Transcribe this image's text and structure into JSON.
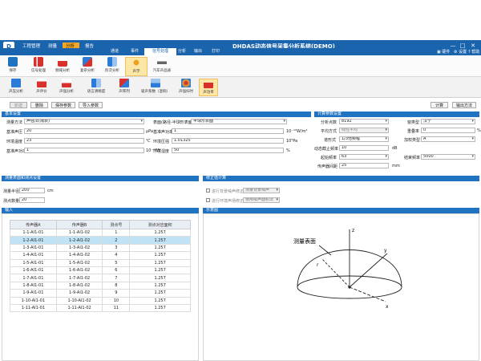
{
  "titlebar": {
    "logo": "D",
    "workflow": [
      "工程管理",
      "测量",
      "分析",
      "报告"
    ],
    "title": "DHDAS动态信号采集分析系统(DEMO)",
    "win_controls": [
      "—",
      "□",
      "✕"
    ]
  },
  "ribbon": {
    "tabs": [
      "通道",
      "事件",
      "信号处理",
      "分析",
      "输出",
      "打印"
    ],
    "active_tab": "信号处理",
    "right_items": [
      "硬件",
      "设置",
      "帮助"
    ]
  },
  "toolbar": [
    {
      "label": "保存",
      "icon": "save-icon",
      "color": "#1f73c1"
    },
    {
      "label": "信号处理",
      "icon": "signal-processing-icon",
      "color": "#d9302c"
    },
    {
      "label": "频域分析",
      "icon": "frequency-analysis-icon",
      "color": "#d9302c"
    },
    {
      "label": "复杂分析",
      "icon": "complex-analysis-icon",
      "color": "#2c7bd9"
    },
    {
      "label": "阶次分析",
      "icon": "order-analysis-icon",
      "color": "#2c7bd9"
    },
    {
      "label": "声学",
      "icon": "acoustics-icon",
      "color": "#f0a020"
    },
    {
      "label": "汽车声品质",
      "icon": "car-sound-quality-icon",
      "color": "#555"
    }
  ],
  "subbar": [
    {
      "label": "声压分析",
      "color": "#2c7bd9"
    },
    {
      "label": "声评价",
      "color": "#d9302c"
    },
    {
      "label": "声强分析",
      "color": "#d9302c"
    },
    {
      "label": "语言清晰度",
      "color": "#2c7bd9"
    },
    {
      "label": "声阵列",
      "color": "#d9302c"
    },
    {
      "label": "吸声系数（混响）",
      "color": "#2c7bd9"
    },
    {
      "label": "声强扫时",
      "color": "#c33"
    },
    {
      "label": "声功率",
      "color": "#d9302c"
    }
  ],
  "actions": {
    "new": "新建",
    "delete": "删除",
    "save_params": "保存参数",
    "import_params": "导入参数",
    "calculate": "计算",
    "export": "输出方法"
  },
  "basic": {
    "header": "基本设置",
    "method_label": "测量方法",
    "method_value": "声强法(隔表)",
    "surface_label": "表面(路径-半球形表面",
    "surface_value": "半球形表面",
    "ref_pressure_label": "基准声压",
    "ref_pressure_value": "20",
    "ref_pressure_unit": "μPa",
    "ref_power_label": "基准声功率",
    "ref_power_value": "1",
    "ref_power_unit": "10⁻¹²W/m²",
    "temp_label": "环境温度",
    "temp_value": "23",
    "temp_unit": "℃",
    "pressure_label": "环境压强",
    "pressure_value": "1.01325",
    "pressure_unit": "10⁵Pa",
    "ref_sound_power_label": "基准声功率",
    "ref_sound_power_value": "1",
    "ref_sound_power_unit": "10⁻¹²W",
    "humidity_label": "环境湿度",
    "humidity_value": "50",
    "humidity_unit": "%"
  },
  "calc": {
    "header": "计算参数设置",
    "points_label": "分析点数",
    "points_value": "8192",
    "window_label": "窗类型",
    "window_value": "汉宁",
    "avg_mode_label": "平均方式",
    "avg_mode_value": "线性平均",
    "overlap_label": "重叠率",
    "overlap_value": "0",
    "overlap_unit": "%",
    "band_label": "谱形式",
    "band_value": "1/3倍频程",
    "weight_label": "加权类型",
    "weight_value": "A",
    "dynamic_label": "动态截止频率",
    "dynamic_value": "10",
    "dynamic_unit": "dB",
    "start_freq_label": "起始频率",
    "start_freq_value": "63",
    "end_freq_label": "结束频率",
    "end_freq_value": "5000",
    "radius_label": "传声器间距",
    "radius_value": "25",
    "radius_unit": "mm"
  },
  "measure": {
    "header": "测量表面和测点设置",
    "radius_label": "测量半径",
    "radius_value": "200",
    "radius_unit": "cm",
    "points_label": "测点数量",
    "points_value": "20"
  },
  "correction": {
    "header": "修正值计算",
    "bg_label": "进行背景噪声修正",
    "bg_value": "测量背景噪声",
    "env_label": "进行环境声场修正",
    "env_value": "使用吸声面积法"
  },
  "input": {
    "header": "输入",
    "columns": [
      "传声器A",
      "传声器B",
      "测点号",
      "测点对应面积"
    ],
    "rows": [
      [
        "1-1-AI1-01",
        "1-1-AI1-02",
        "1",
        "1.257"
      ],
      [
        "1-2-AI1-01",
        "1-2-AI1-02",
        "2",
        "1.257"
      ],
      [
        "1-3-AI1-01",
        "1-3-AI1-02",
        "3",
        "1.257"
      ],
      [
        "1-4-AI1-01",
        "1-4-AI1-02",
        "4",
        "1.257"
      ],
      [
        "1-5-AI1-01",
        "1-5-AI1-02",
        "5",
        "1.257"
      ],
      [
        "1-6-AI1-01",
        "1-6-AI1-02",
        "6",
        "1.257"
      ],
      [
        "1-7-AI1-01",
        "1-7-AI1-02",
        "7",
        "1.257"
      ],
      [
        "1-8-AI1-01",
        "1-8-AI1-02",
        "8",
        "1.257"
      ],
      [
        "1-9-AI1-01",
        "1-9-AI1-02",
        "9",
        "1.257"
      ],
      [
        "1-10-AI1-01",
        "1-10-AI1-02",
        "10",
        "1.257"
      ],
      [
        "1-11-AI1-01",
        "1-11-AI1-02",
        "11",
        "1.257"
      ]
    ],
    "selected_row": 1
  },
  "diagram": {
    "header": "示意图",
    "surface_label": "测量表面",
    "axis_z": "z",
    "axis_y": "y",
    "axis_x": "x",
    "radius": "r"
  }
}
